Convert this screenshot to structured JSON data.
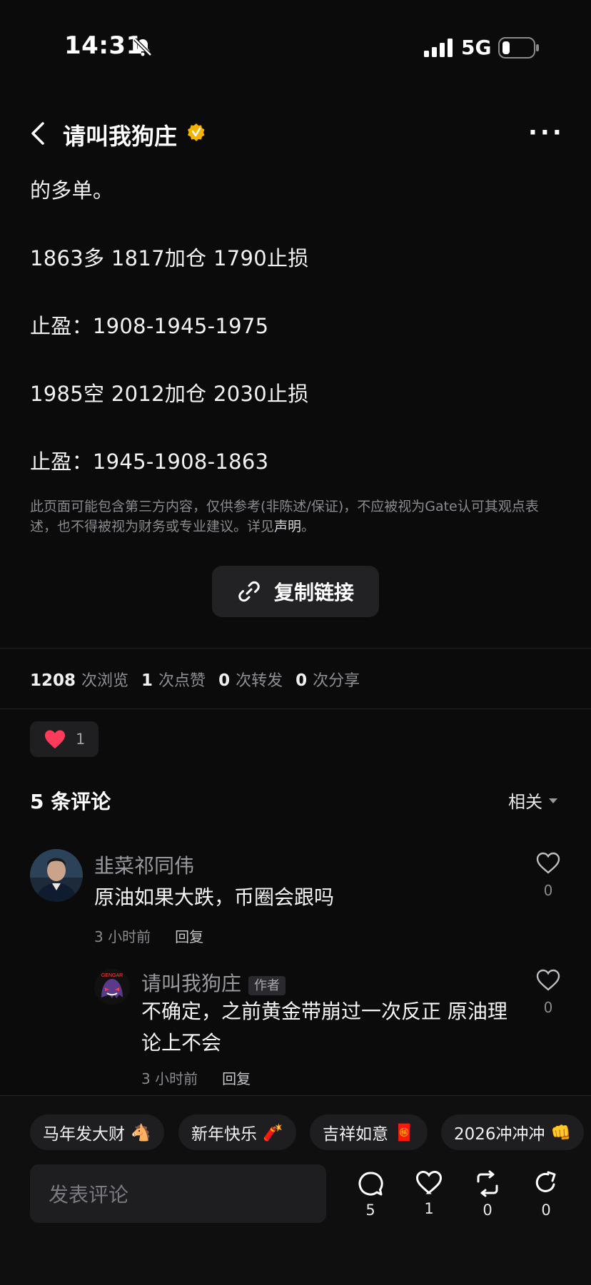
{
  "status_bar": {
    "time": "14:31",
    "network": "5G"
  },
  "header": {
    "title": "请叫我狗庄"
  },
  "post": {
    "lines": [
      "的多单。",
      "1863多 1817加仓 1790止损",
      "止盈：1908-1945-1975",
      "1985空 2012加仓 2030止损",
      "止盈：1945-1908-1863"
    ],
    "disclaimer_prefix": "此页面可能包含第三方内容，仅供参考(非陈述/保证)，不应被视为Gate认可其观点表述，也不得被视为财务或专业建议。详见",
    "disclaimer_link": "声明",
    "disclaimer_suffix": "。",
    "copy_link_label": "复制链接"
  },
  "stats": {
    "views": "1208",
    "views_label": "次浏览",
    "likes": "1",
    "likes_label": "次点赞",
    "reposts": "0",
    "reposts_label": "次转发",
    "shares": "0",
    "shares_label": "次分享"
  },
  "reaction": {
    "count": "1"
  },
  "comments": {
    "title": "5 条评论",
    "sort_label": "相关",
    "items": [
      {
        "name": "韭菜祁同伟",
        "text": "原油如果大跌，币圈会跟吗",
        "time": "3 小时前",
        "reply_label": "回复",
        "likes": "0"
      },
      {
        "name": "请叫我狗庄",
        "author_tag": "作者",
        "text_line1": "不确定，之前黄金带崩过一次反正 原油理",
        "text_line2": "论上不会",
        "time": "3 小时前",
        "reply_label": "回复",
        "likes": "0"
      }
    ]
  },
  "chips": [
    {
      "label": "马年发大财",
      "emoji": "🐴"
    },
    {
      "label": "新年快乐",
      "emoji": "🧨"
    },
    {
      "label": "吉祥如意",
      "emoji": "🧧"
    },
    {
      "label": "2026冲冲冲",
      "emoji": "👊"
    }
  ],
  "composer": {
    "placeholder": "发表评论"
  },
  "actions": {
    "comments": "5",
    "likes": "1",
    "reposts": "0",
    "shares": "0"
  },
  "colors": {
    "background": "#0b0b0c",
    "like_red": "#ff3b5c",
    "verified_gold": "#f5b301"
  }
}
